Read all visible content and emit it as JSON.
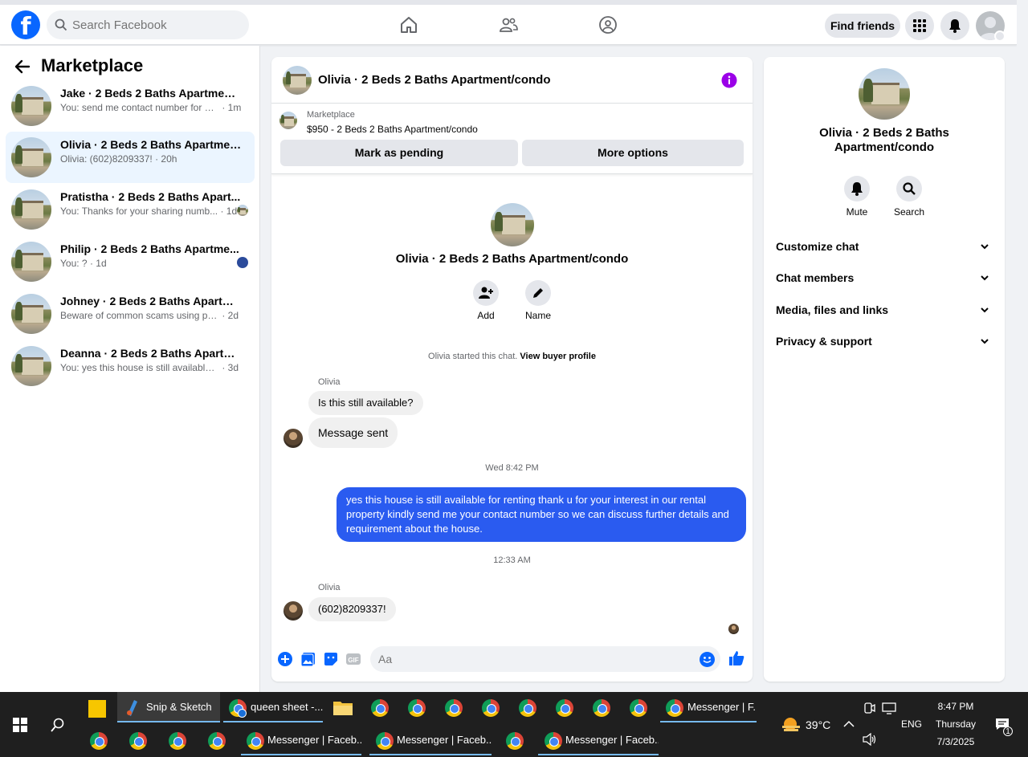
{
  "topbar": {
    "logo": "f",
    "search_placeholder": "Search Facebook",
    "find_friends": "Find friends",
    "icons": [
      "home-icon",
      "friends-icon",
      "groups-icon",
      "apps-grid-icon",
      "notifications-icon"
    ]
  },
  "sidebar": {
    "title": "Marketplace",
    "conversations": [
      {
        "name": "Jake · 2 Beds 2 Baths Apartment/c...",
        "preview": "You: send me contact number for mo...",
        "time": "· 1m"
      },
      {
        "name": "Olivia · 2 Beds 2 Baths Apartment/...",
        "preview": "Olivia: (602)8209337!",
        "time": "· 20h"
      },
      {
        "name": "Pratistha · 2 Beds 2 Baths Apart...",
        "preview": "You: Thanks for your sharing numb...",
        "time": "· 1d"
      },
      {
        "name": "Philip · 2 Beds 2 Baths Apartme...",
        "preview": "You: ?",
        "time": "· 1d"
      },
      {
        "name": "Johney · 2 Beds 2 Baths Apartmen...",
        "preview": "Beware of common scams using pay...",
        "time": "· 2d"
      },
      {
        "name": "Deanna · 2 Beds 2 Baths Apartmen...",
        "preview": "You: yes this house is still available for...",
        "time": "· 3d"
      }
    ]
  },
  "chat": {
    "title": "Olivia · 2 Beds 2 Baths Apartment/condo",
    "marketplace_label": "Marketplace",
    "listing": "$950 - 2 Beds 2 Baths Apartment/condo",
    "mark_pending": "Mark as pending",
    "more_options": "More options",
    "center_name": "Olivia · 2 Beds 2 Baths Apartment/condo",
    "add_label": "Add",
    "name_label": "Name",
    "started_text": "Olivia started this chat.",
    "view_profile": "View buyer profile",
    "sender": "Olivia",
    "msg1": "Is this still available?",
    "msg2": "Message sent",
    "ts1": "Wed 8:42 PM",
    "out_msg": "yes this house is still  available for renting thank u for your interest  in our rental property kindly send me your contact number so we can discuss further details and requirement about the house.",
    "ts2": "12:33 AM",
    "msg3": "(602)8209337!",
    "composer_placeholder": "Aa",
    "accent": "#2a5bf0",
    "info_color": "#9b00e8"
  },
  "right_panel": {
    "name": "Olivia · 2 Beds 2 Baths Apartment/condo",
    "mute": "Mute",
    "search": "Search",
    "sections": [
      "Customize chat",
      "Chat members",
      "Media, files and links",
      "Privacy & support"
    ]
  },
  "taskbar": {
    "snip": "Snip & Sketch",
    "queen": "queen sheet -...",
    "messenger_top": "Messenger | F...",
    "messenger_1": "Messenger | Faceb...",
    "messenger_2": "Messenger | Faceb...",
    "messenger_3": "Messenger | Faceb...",
    "temp": "39°C",
    "lang": "ENG",
    "time": "8:47 PM",
    "day": "Thursday",
    "date": "7/3/2025",
    "notif_count": "1"
  }
}
